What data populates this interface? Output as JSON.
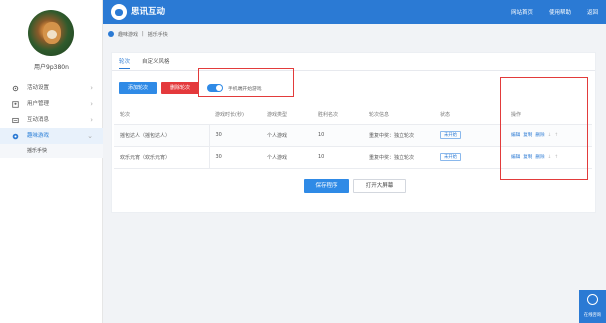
{
  "user": {
    "name": "用户9p380n"
  },
  "sidebar": {
    "items": [
      {
        "label": "活动设置",
        "icon": "gear-icon"
      },
      {
        "label": "用户管理",
        "icon": "user-icon"
      },
      {
        "label": "互动消息",
        "icon": "message-icon"
      },
      {
        "label": "趣味游戏",
        "icon": "game-icon",
        "active": true
      }
    ],
    "sub_item": "摇乐手快"
  },
  "header": {
    "brand": "思讯互动",
    "nav": [
      "网站首页",
      "使用帮助",
      "返回"
    ],
    "color": "#2b7ad4"
  },
  "breadcrumb": {
    "root": "趣味游戏",
    "current": "摇乐手快"
  },
  "tabs": [
    "轮次",
    "自定义风格"
  ],
  "toolbar": {
    "add_label": "添加轮次",
    "delete_label": "删除轮次",
    "toggle_label": "手机端开始游戏",
    "toggle_on": true
  },
  "table": {
    "headers": [
      "轮次",
      "游戏时长(秒)",
      "游戏类型",
      "胜利名次",
      "轮次信息",
      "状态",
      "操作"
    ],
    "rows": [
      {
        "name": "摇包达人（摇包达人）",
        "duration": "30",
        "type": "个人游戏",
        "rank": "10",
        "info": "重复中奖：独立轮次",
        "status": "未开始",
        "ops": [
          "编辑",
          "复制",
          "删除",
          "↓",
          "↑"
        ]
      },
      {
        "name": "欢乐元宵（欢乐元宵）",
        "duration": "30",
        "type": "个人游戏",
        "rank": "10",
        "info": "重复中奖：独立轮次",
        "status": "未开始",
        "ops": [
          "编辑",
          "复制",
          "删除",
          "↓",
          "↑"
        ]
      }
    ]
  },
  "actions": {
    "save_label": "保存程序",
    "screen_label": "打开大屏幕"
  },
  "service": {
    "label": "在线咨询"
  },
  "accent": {
    "primary": "#2f8ae6",
    "danger": "#e4393c",
    "annotation": "#e23b3b"
  }
}
